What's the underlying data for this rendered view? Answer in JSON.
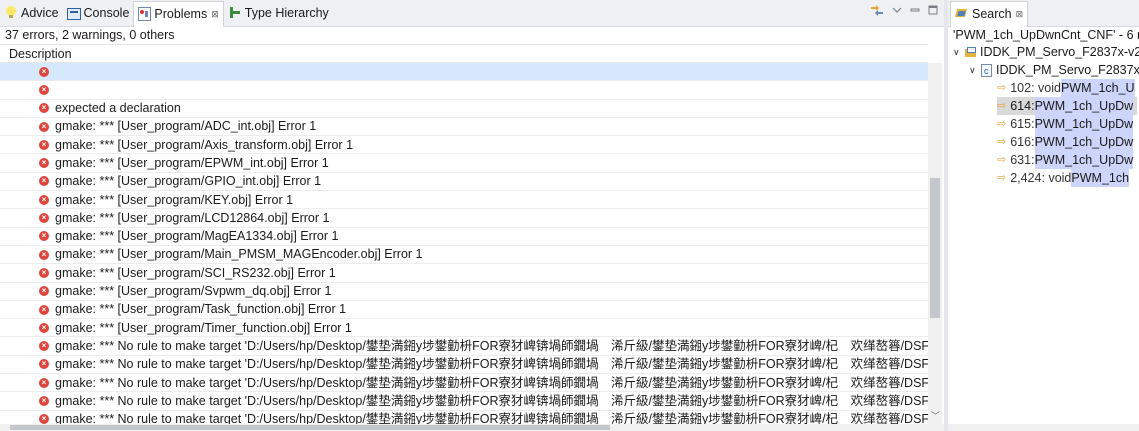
{
  "left_tabs": [
    {
      "label": "Advice",
      "icon": "lightbulb-icon"
    },
    {
      "label": "Console",
      "icon": "console-icon"
    },
    {
      "label": "Problems",
      "icon": "problems-icon",
      "active": true,
      "close": "⊠"
    },
    {
      "label": "Type Hierarchy",
      "icon": "type-hierarchy-icon"
    }
  ],
  "summary": "37 errors, 2 warnings, 0 others",
  "column_header": "Description",
  "problems": [
    {
      "text": "",
      "selected": true
    },
    {
      "text": ""
    },
    {
      "text": "expected a declaration"
    },
    {
      "text": "gmake: *** [User_program/ADC_int.obj] Error 1"
    },
    {
      "text": "gmake: *** [User_program/Axis_transform.obj] Error 1"
    },
    {
      "text": "gmake: *** [User_program/EPWM_int.obj] Error 1"
    },
    {
      "text": "gmake: *** [User_program/GPIO_int.obj] Error 1"
    },
    {
      "text": "gmake: *** [User_program/KEY.obj] Error 1"
    },
    {
      "text": "gmake: *** [User_program/LCD12864.obj] Error 1"
    },
    {
      "text": "gmake: *** [User_program/MagEA1334.obj] Error 1"
    },
    {
      "text": "gmake: *** [User_program/Main_PMSM_MAGEncoder.obj] Error 1"
    },
    {
      "text": "gmake: *** [User_program/SCI_RS232.obj] Error 1"
    },
    {
      "text": "gmake: *** [User_program/Svpwm_dq.obj] Error 1"
    },
    {
      "text": "gmake: *** [User_program/Task_function.obj] Error 1"
    },
    {
      "text": "gmake: *** [User_program/Timer_function.obj] Error 1"
    },
    {
      "text": "gmake: *** No rule to make target 'D:/Users/hp/Desktop/鐢垫満鎺у埗鐢勭枡FOR寮犲崥锛堝師鐗堝　浠斤級/鐢垫満鎺у埗鐢勭枡FOR寮犲崥/杞　欢缂嶅簭/DSF"
    },
    {
      "text": "gmake: *** No rule to make target 'D:/Users/hp/Desktop/鐢垫満鎺у埗鐢勭枡FOR寮犲崥锛堝師鐗堝　浠斤級/鐢垫満鎺у埗鐢勭枡FOR寮犲崥/杞　欢缂嶅簭/DSF"
    },
    {
      "text": "gmake: *** No rule to make target 'D:/Users/hp/Desktop/鐢垫満鎺у埗鐢勭枡FOR寮犲崥锛堝師鐗堝　浠斤級/鐢垫満鎺у埗鐢勭枡FOR寮犲崥/杞　欢缂嶅簭/DSF"
    },
    {
      "text": "gmake: *** No rule to make target 'D:/Users/hp/Desktop/鐢垫満鎺у埗鐢勭枡FOR寮犲崥锛堝師鐗堝　浠斤級/鐢垫満鎺у埗鐢勭枡FOR寮犲崥/杞　欢缂嶅簭/DSF"
    },
    {
      "text": "gmake: *** No rule to make target 'D:/Users/hp/Desktop/鐢垫満鎺у埗鐢勭枡FOR寮犲崥锛堝師鐗堝　浠斤級/鐢垫満鎺у埗鐢勭枡FOR寮犲崥/杞　欢缂嶅簭/DSF"
    }
  ],
  "search_view": {
    "tab_label": "Search",
    "tab_close": "⊠",
    "title": "'PWM_1ch_UpDwnCnt_CNF' - 6 r",
    "project": "IDDK_PM_Servo_F2837x-v2",
    "file": "IDDK_PM_Servo_F2837x",
    "matches": [
      {
        "prefix": "102: void ",
        "highlight": "PWM_1ch_U",
        "selected": false
      },
      {
        "prefix": "614: ",
        "highlight": "PWM_1ch_UpDw",
        "selected": true
      },
      {
        "prefix": "615: ",
        "highlight": "PWM_1ch_UpDw",
        "selected": false
      },
      {
        "prefix": "616: ",
        "highlight": "PWM_1ch_UpDw",
        "selected": false
      },
      {
        "prefix": "631: ",
        "highlight": "PWM_1ch_UpDw",
        "selected": false
      },
      {
        "prefix": "2,424: void ",
        "highlight": "PWM_1ch",
        "selected": false
      }
    ]
  },
  "colors": {
    "selection": "#d6e8fb",
    "error_icon": "#e0453b",
    "match_highlight": "#cdd5fb"
  }
}
